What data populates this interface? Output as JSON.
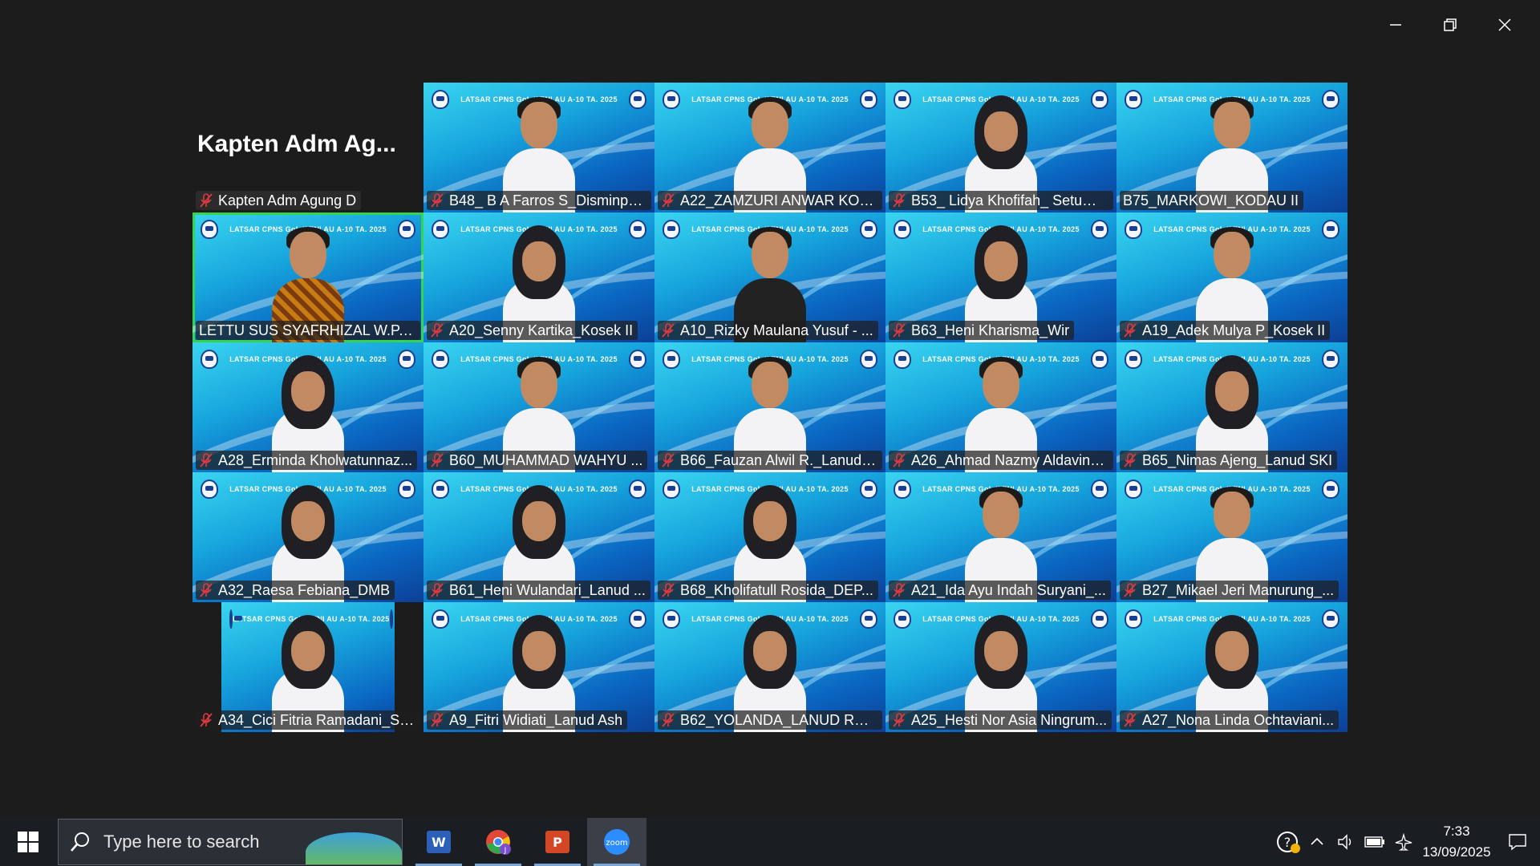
{
  "window": {
    "controls": [
      "minimize",
      "restore",
      "close"
    ]
  },
  "gallery": {
    "banner_text": "LATSAR CPNS Gol. II TNI AU A-10 TA. 2025",
    "host_big_name": "Kapten Adm Ag...",
    "participants": [
      {
        "name": "Kapten Adm Agung D",
        "muted": true,
        "type": "empty"
      },
      {
        "name": "B48_ B A Farros S_Disminper...",
        "muted": true,
        "type": "male"
      },
      {
        "name": "A22_ZAMZURI ANWAR KOS...",
        "muted": true,
        "type": "male"
      },
      {
        "name": "B53_ Lidya Khofifah_ Setumau",
        "muted": true,
        "type": "hijab"
      },
      {
        "name": "B75_MARKOWI_KODAU II",
        "muted": false,
        "type": "male"
      },
      {
        "name": "LETTU SUS SYAFRHIZAL W.P., S...",
        "muted": false,
        "type": "batik",
        "active": true
      },
      {
        "name": "A20_Senny Kartika_Kosek II",
        "muted": true,
        "type": "hijab"
      },
      {
        "name": "A10_Rizky Maulana Yusuf - ...",
        "muted": true,
        "type": "dark"
      },
      {
        "name": "B63_Heni Kharisma_Wir",
        "muted": true,
        "type": "hijab"
      },
      {
        "name": "A19_Adek Mulya P_Kosek II",
        "muted": true,
        "type": "male"
      },
      {
        "name": "A28_Erminda Kholwatunnaz...",
        "muted": true,
        "type": "hijab"
      },
      {
        "name": "B60_MUHAMMAD WAHYU ...",
        "muted": true,
        "type": "male"
      },
      {
        "name": "B66_Fauzan Alwil R._Lanud ...",
        "muted": true,
        "type": "male"
      },
      {
        "name": "A26_Ahmad Nazmy Aldavin_...",
        "muted": true,
        "type": "male"
      },
      {
        "name": "B65_Nimas Ajeng_Lanud SKI",
        "muted": true,
        "type": "hijab"
      },
      {
        "name": "A32_Raesa Febiana_DMB",
        "muted": true,
        "type": "hijab"
      },
      {
        "name": "B61_Heni Wulandari_Lanud ...",
        "muted": true,
        "type": "hijab"
      },
      {
        "name": "B68_Kholifatull Rosida_DEP...",
        "muted": true,
        "type": "hijab"
      },
      {
        "name": "A21_Ida Ayu Indah Suryani_...",
        "muted": true,
        "type": "male"
      },
      {
        "name": "B27_Mikael Jeri Manurung_...",
        "muted": true,
        "type": "male"
      },
      {
        "name": "A34_Cici Fitria Ramadani_Sik...",
        "muted": true,
        "type": "hijab",
        "narrow": true
      },
      {
        "name": "A9_Fitri Widiati_Lanud Ash",
        "muted": true,
        "type": "hijab"
      },
      {
        "name": "B62_YOLANDA_LANUD RHF ...",
        "muted": true,
        "type": "hijab"
      },
      {
        "name": "A25_Hesti Nor Asia Ningrum...",
        "muted": true,
        "type": "hijab"
      },
      {
        "name": "A27_Nona Linda Ochtaviani...",
        "muted": true,
        "type": "hijab"
      }
    ]
  },
  "taskbar": {
    "search_placeholder": "Type here to search",
    "apps": [
      {
        "name": "word-icon",
        "label": "W",
        "color": "#2b5fb8"
      },
      {
        "name": "chrome-icon",
        "label": "J",
        "color": "#e2483a"
      },
      {
        "name": "powerpoint-icon",
        "label": "P",
        "color": "#d24726"
      },
      {
        "name": "zoom-icon",
        "label": "zoom",
        "color": "#2d8cff"
      }
    ],
    "time": "7:33",
    "date": "13/09/2025"
  }
}
